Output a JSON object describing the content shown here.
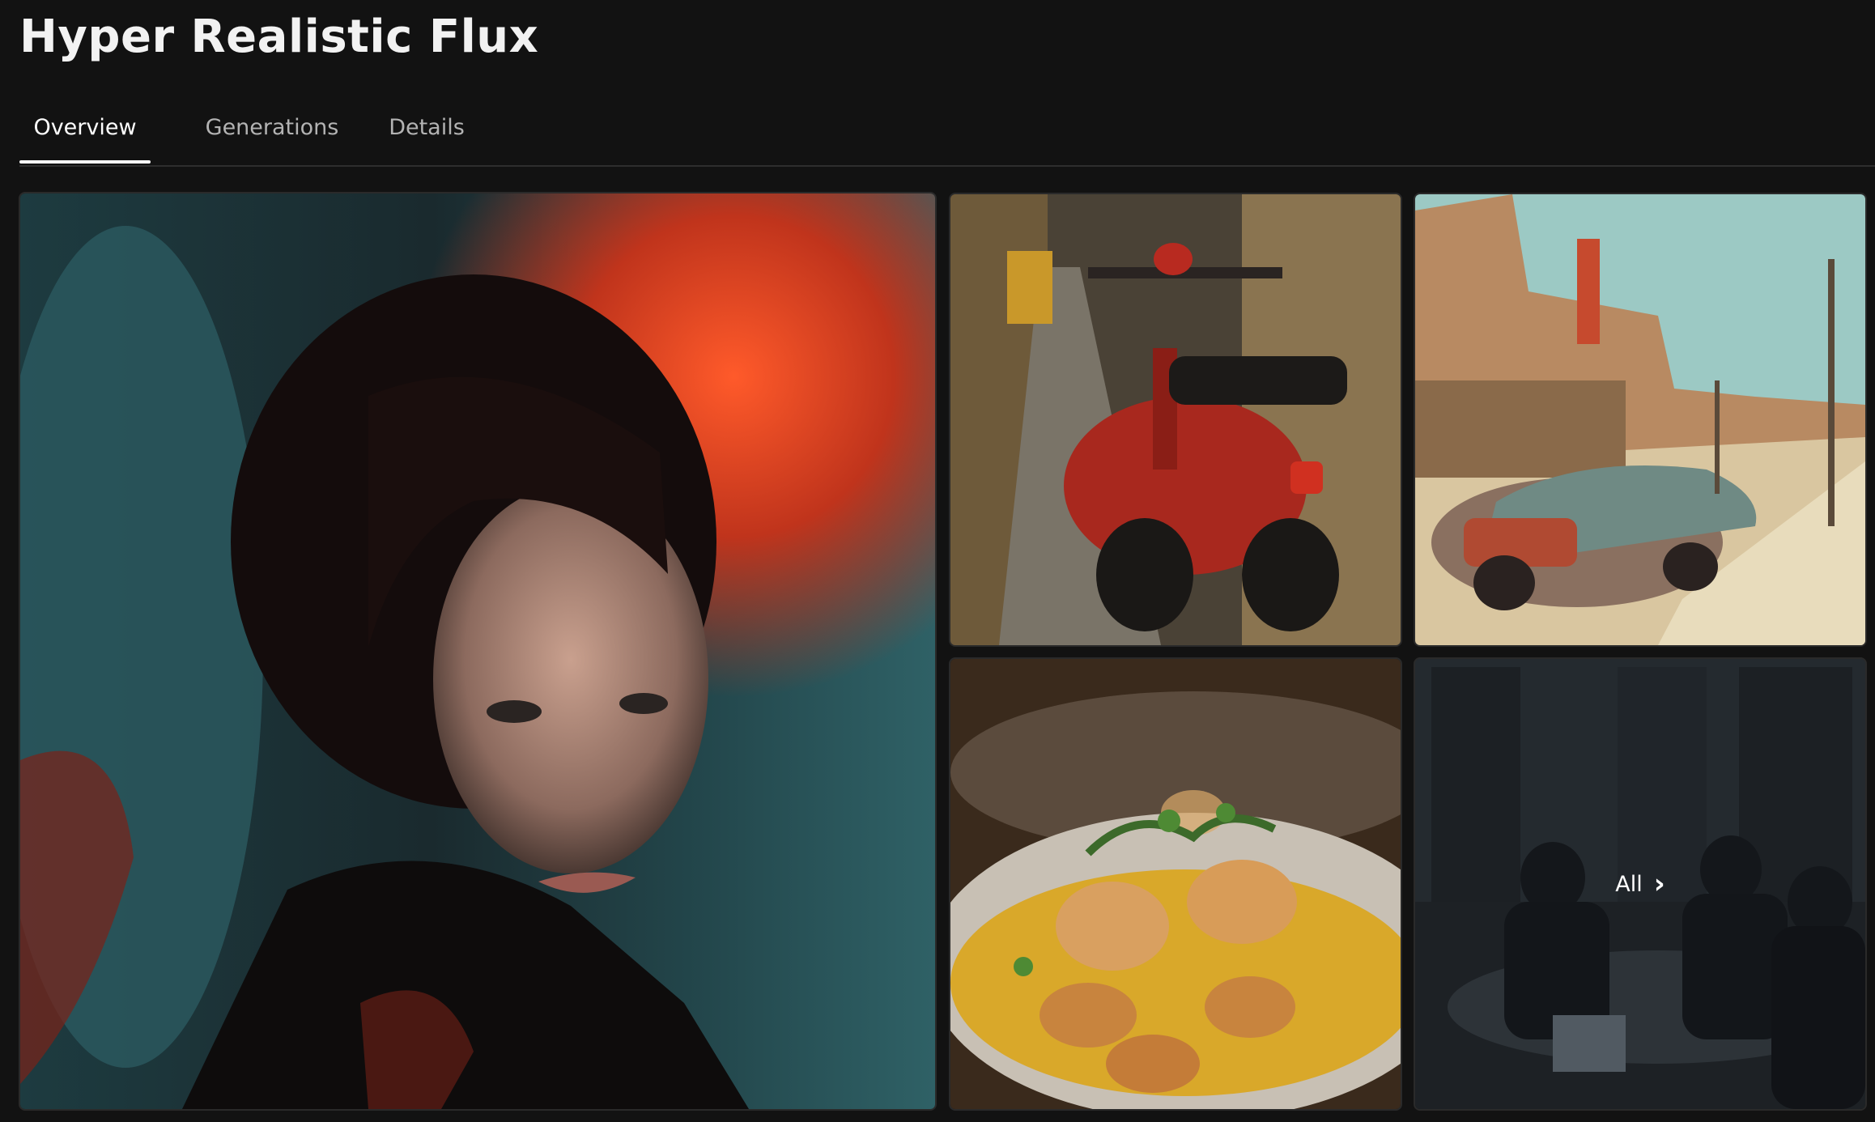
{
  "page": {
    "title": "Hyper Realistic Flux"
  },
  "tabs": [
    {
      "label": "Overview",
      "active": true
    },
    {
      "label": "Generations",
      "active": false
    },
    {
      "label": "Details",
      "active": false
    }
  ],
  "gallery": {
    "items": [
      {
        "subject": "woman-in-rain-neon-portrait"
      },
      {
        "subject": "red-scooter-in-alley"
      },
      {
        "subject": "rusty-car-desert-town"
      },
      {
        "subject": "seared-scallops-dish"
      },
      {
        "subject": "business-meeting-office"
      }
    ],
    "all_label": "All",
    "all_icon": "chevron-right-icon"
  },
  "colors": {
    "background": "#121212",
    "text_primary": "#f2f2f2",
    "text_muted": "#b3b3b3",
    "divider": "#2e2e2e"
  }
}
